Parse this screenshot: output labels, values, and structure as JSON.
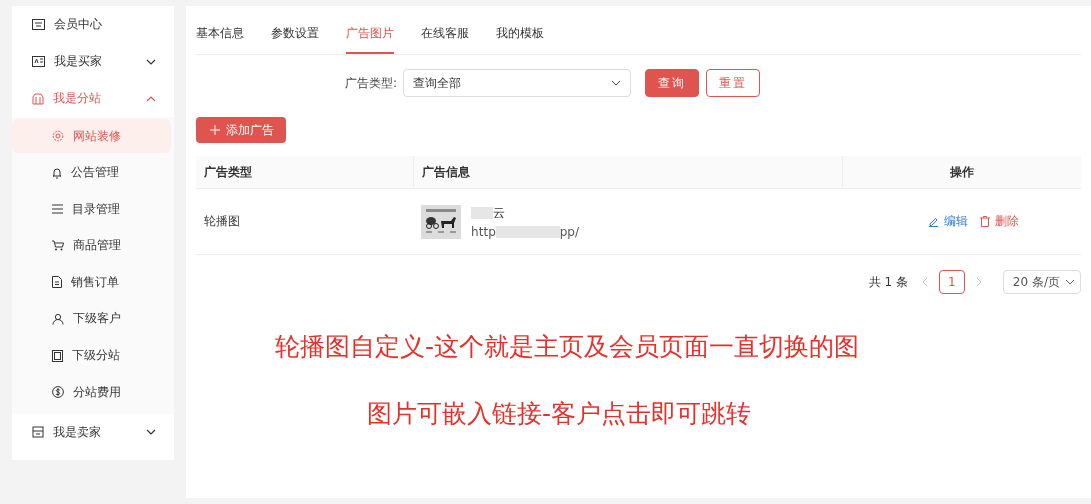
{
  "sidebar": {
    "items": [
      {
        "label": "会员中心",
        "kind": "link",
        "selected": false
      },
      {
        "label": "我是买家",
        "kind": "group",
        "expanded": false,
        "selected": false
      },
      {
        "label": "我是分站",
        "kind": "group",
        "expanded": true,
        "selected": true,
        "children": [
          {
            "label": "网站装修",
            "selected": true
          },
          {
            "label": "公告管理",
            "selected": false
          },
          {
            "label": "目录管理",
            "selected": false
          },
          {
            "label": "商品管理",
            "selected": false
          },
          {
            "label": "销售订单",
            "selected": false
          },
          {
            "label": "下级客户",
            "selected": false
          },
          {
            "label": "下级分站",
            "selected": false
          },
          {
            "label": "分站费用",
            "selected": false
          }
        ]
      },
      {
        "label": "我是卖家",
        "kind": "group",
        "expanded": false,
        "selected": false
      }
    ]
  },
  "tabs": [
    {
      "label": "基本信息",
      "selected": false
    },
    {
      "label": "参数设置",
      "selected": false
    },
    {
      "label": "广告图片",
      "selected": true
    },
    {
      "label": "在线客服",
      "selected": false
    },
    {
      "label": "我的模板",
      "selected": false
    }
  ],
  "filter": {
    "label": "广告类型:",
    "select_value": "查询全部",
    "buttons": [
      {
        "label": "查询",
        "kind": "primary"
      },
      {
        "label": "重置",
        "kind": "outline"
      }
    ]
  },
  "add_button": {
    "label": "添加广告"
  },
  "table": {
    "columns": [
      "广告类型",
      "广告信息",
      "操作"
    ],
    "rows": [
      {
        "type": "轮播图",
        "image": {
          "kind": "picture"
        },
        "title": "云",
        "url_start": "http",
        "url_end": "pp/",
        "actions": [
          {
            "label": "编辑",
            "kind": "edit"
          },
          {
            "label": "删除",
            "kind": "delete"
          }
        ]
      }
    ]
  },
  "pagination": {
    "total": "共 1 条",
    "pages": [
      {
        "label": "1",
        "selected": true
      }
    ],
    "page_size": "20 条/页"
  },
  "annotations": [
    "轮播图自定义-这个就是主页及会员页面一直切换的图",
    "图片可嵌入链接-客户点击即可跳转"
  ]
}
